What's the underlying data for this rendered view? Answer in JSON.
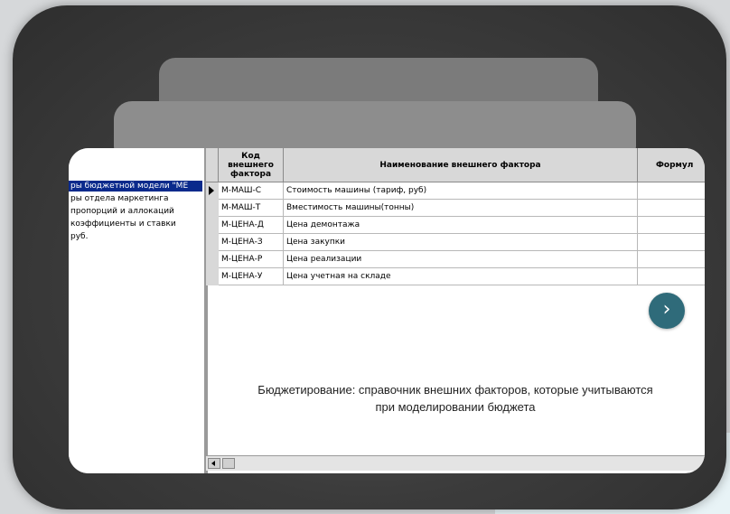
{
  "tree": {
    "items": [
      {
        "label": "ры бюджетной модели \"МЕ",
        "selected": true
      },
      {
        "label": "ры отдела маркетинга",
        "selected": false
      },
      {
        "label": "пропорций и аллокаций",
        "selected": false
      },
      {
        "label": "коэффициенты и ставки",
        "selected": false
      },
      {
        "label": "руб.",
        "selected": false
      }
    ]
  },
  "grid": {
    "headers": {
      "code": "Код внешнего фактора",
      "name": "Наименование внешнего фактора",
      "formula": "Формул"
    },
    "rows": [
      {
        "code": "М-МАШ-С",
        "name": "Стоимость машины (тариф, руб)"
      },
      {
        "code": "М-МАШ-Т",
        "name": "Вместимость машины(тонны)"
      },
      {
        "code": "М-ЦЕНА-Д",
        "name": "Цена демонтажа"
      },
      {
        "code": "М-ЦЕНА-З",
        "name": "Цена закупки"
      },
      {
        "code": "М-ЦЕНА-Р",
        "name": "Цена реализации"
      },
      {
        "code": "М-ЦЕНА-У",
        "name": "Цена учетная на складе"
      }
    ]
  },
  "caption": {
    "line1": "Бюджетирование: справочник внешних факторов, которые учитываются",
    "line2": "при моделировании бюджета"
  },
  "next_button": {
    "icon": "chevron-right-icon",
    "glyph": "›"
  },
  "colors": {
    "selection": "#0a2a8c",
    "accent": "#2f6b7a"
  }
}
